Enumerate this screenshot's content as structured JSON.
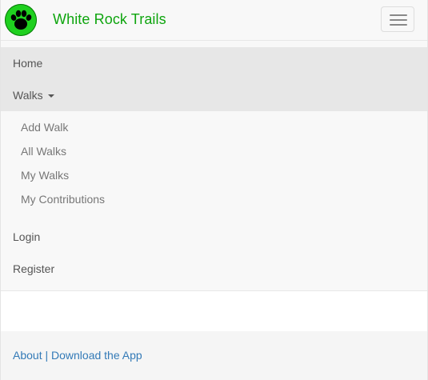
{
  "brand": {
    "title": "White Rock Trails",
    "logo_icon": "paw-print-icon",
    "logo_color": "#1fd01f"
  },
  "toggle": {
    "icon": "hamburger-menu-icon"
  },
  "nav": {
    "home": "Home",
    "walks": "Walks",
    "walks_submenu": [
      "Add Walk",
      "All Walks",
      "My Walks",
      "My Contributions"
    ],
    "login": "Login",
    "register": "Register"
  },
  "footer": {
    "about": "About",
    "separator": "|",
    "download": "Download the App",
    "link_color": "#337ab7"
  }
}
